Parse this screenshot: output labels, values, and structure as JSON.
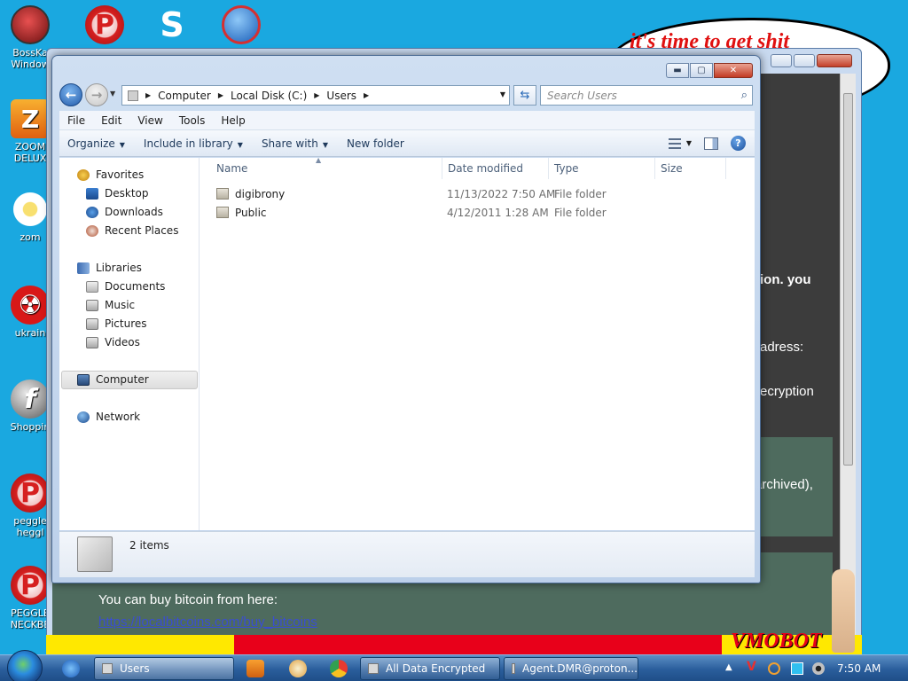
{
  "desktop": {
    "icons": [
      {
        "label": "BossKa\nWindow",
        "glyph": ""
      },
      {
        "label": "",
        "glyph": "P"
      },
      {
        "label": "",
        "glyph": "S"
      },
      {
        "label": "",
        "glyph": ""
      },
      {
        "label": "ZOOM\nDELUX",
        "glyph": "Z"
      },
      {
        "label": "zom",
        "glyph": ""
      },
      {
        "label": "ukrain",
        "glyph": "☢"
      },
      {
        "label": "Shoppin",
        "glyph": "f"
      },
      {
        "label": "peggle\nheggl",
        "glyph": "P"
      },
      {
        "label": "PEGGLE\nNECKBE",
        "glyph": "P"
      }
    ]
  },
  "ransom": {
    "bubble_text": "it's time to get shit",
    "lines": [
      "ion. you",
      "adress:",
      "ecryption",
      "archived),"
    ],
    "bitcoin_text": "You can buy bitcoin from here:",
    "bitcoin_link": "https://localbitcoins.com/buy_bitcoins",
    "strip_logo": "VMOBOT"
  },
  "explorer": {
    "breadcrumbs": [
      "Computer",
      "Local Disk (C:)",
      "Users"
    ],
    "search_placeholder": "Search Users",
    "menu": [
      "File",
      "Edit",
      "View",
      "Tools",
      "Help"
    ],
    "commands": [
      {
        "label": "Organize",
        "dropdown": true
      },
      {
        "label": "Include in library",
        "dropdown": true
      },
      {
        "label": "Share with",
        "dropdown": true
      },
      {
        "label": "New folder",
        "dropdown": false
      }
    ],
    "nav": {
      "favorites": "Favorites",
      "desktop": "Desktop",
      "downloads": "Downloads",
      "recent": "Recent Places",
      "libraries": "Libraries",
      "documents": "Documents",
      "music": "Music",
      "pictures": "Pictures",
      "videos": "Videos",
      "computer": "Computer",
      "network": "Network"
    },
    "columns": [
      "Name",
      "Date modified",
      "Type",
      "Size"
    ],
    "rows": [
      {
        "name": "digibrony",
        "date": "11/13/2022 7:50 AM",
        "type": "File folder",
        "size": ""
      },
      {
        "name": "Public",
        "date": "4/12/2011 1:28 AM",
        "type": "File folder",
        "size": ""
      }
    ],
    "status": "2 items"
  },
  "taskbar": {
    "buttons": [
      "Users",
      "All Data Encrypted",
      "Agent.DMR@proton..."
    ],
    "clock": "7:50 AM"
  },
  "colors": {
    "desktop": "#1aa8e0",
    "taskbar": "#2a5e9c",
    "ransom_bg": "#3c3c3c",
    "ransom_panel": "#4e6b5e",
    "bubble_text": "#e01010"
  }
}
